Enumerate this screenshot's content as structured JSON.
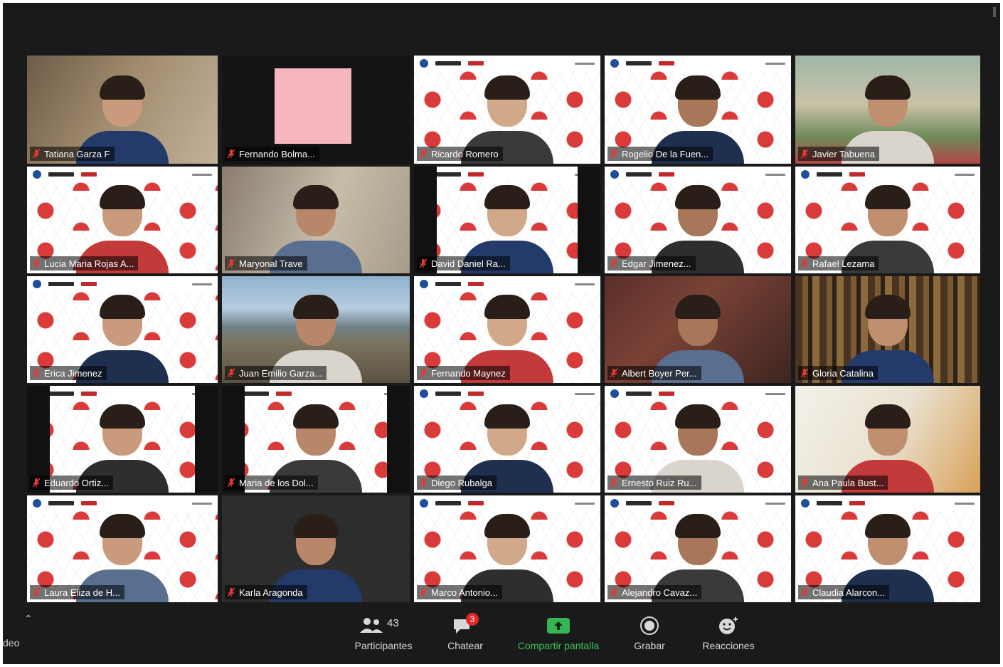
{
  "participants": [
    {
      "name": "Tatiana Garza F",
      "background": "room",
      "active": true
    },
    {
      "name": "Fernando Bolma...",
      "background": "pink"
    },
    {
      "name": "Ricardo Romero",
      "background": "hex"
    },
    {
      "name": "Rogelio De la Fuen...",
      "background": "hex"
    },
    {
      "name": "Javier Tabuena",
      "background": "garden"
    },
    {
      "name": "Lucia Maria Rojas A...",
      "background": "hex"
    },
    {
      "name": "Maryonal Trave",
      "background": "wall"
    },
    {
      "name": "David Daniel Ra...",
      "background": "hexboxed"
    },
    {
      "name": "Edgar Jimenez...",
      "background": "hex"
    },
    {
      "name": "Rafael Lezama",
      "background": "hex"
    },
    {
      "name": "Erica Jimenez",
      "background": "hex"
    },
    {
      "name": "Juan Emilio Garza...",
      "background": "mountain"
    },
    {
      "name": "Fernando Maynez",
      "background": "hex"
    },
    {
      "name": "Albert Boyer Per...",
      "background": "brick"
    },
    {
      "name": "Gloria Catalina",
      "background": "books"
    },
    {
      "name": "Eduardo Ortiz...",
      "background": "hexboxed"
    },
    {
      "name": "Maria de los Dol...",
      "background": "hexboxed"
    },
    {
      "name": "Diego Rubalga",
      "background": "hex"
    },
    {
      "name": "Ernesto Ruiz Ru...",
      "background": "hex"
    },
    {
      "name": "Ana Paula Bust...",
      "background": "bright"
    },
    {
      "name": "Laura Eliza de H...",
      "background": "hex"
    },
    {
      "name": "Karla Aragonda",
      "background": "dark"
    },
    {
      "name": "Marco Antonio...",
      "background": "hex"
    },
    {
      "name": "Alejandro Cavaz...",
      "background": "hex"
    },
    {
      "name": "Claudia Alarcon...",
      "background": "hex"
    }
  ],
  "toolbar": {
    "video_label": "deo",
    "participants_label": "Participantes",
    "participants_count": "43",
    "chat_label": "Chatear",
    "chat_badge": "3",
    "share_label": "Compartir pantalla",
    "record_label": "Grabar",
    "reactions_label": "Reacciones"
  },
  "colors": {
    "active_speaker": "#c9e646",
    "share_green": "#40c060",
    "badge_red": "#e02828",
    "hex_red": "#d93b3b"
  }
}
